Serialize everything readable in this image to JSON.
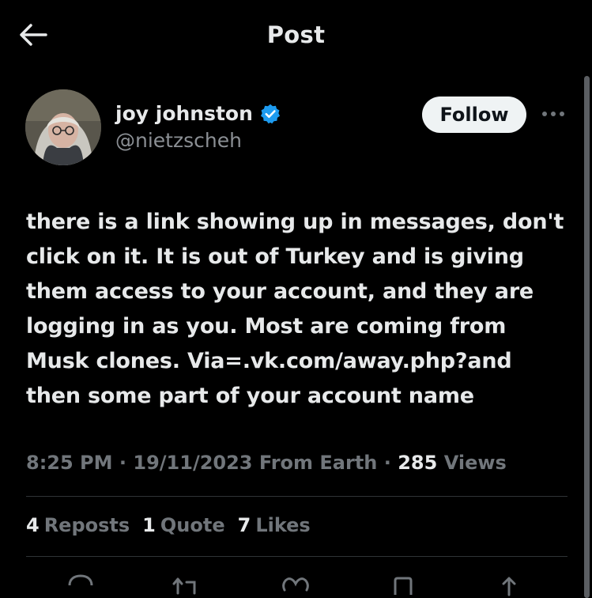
{
  "header": {
    "title": "Post",
    "back_icon": "arrow-left-icon"
  },
  "author": {
    "name": "joy johnston",
    "handle": "@nietzscheh",
    "verified": true,
    "verified_color": "#1d9bf0"
  },
  "follow_label": "Follow",
  "more_icon": "ellipsis-icon",
  "post": {
    "text": "there is a link showing up in messages, don't click on it.  It is out of Turkey and is giving them access to your account, and they are logging in as you.  Most are coming from Musk clones.  Via=.vk.com/away.php?and then some part of your account name"
  },
  "meta": {
    "time": "8:25 PM",
    "date": "19/11/2023",
    "source": "From Earth",
    "views_count": "285",
    "views_label": "Views"
  },
  "stats": {
    "reposts_count": "4",
    "reposts_label": "Reposts",
    "quotes_count": "1",
    "quotes_label": "Quote",
    "likes_count": "7",
    "likes_label": "Likes"
  },
  "actions": [
    "reply-icon",
    "repost-icon",
    "like-icon",
    "bookmark-icon",
    "share-icon"
  ],
  "colors": {
    "background": "#000000",
    "text_primary": "#e7e9ea",
    "text_secondary": "#71767b",
    "divider": "#2f3336",
    "follow_bg": "#eff3f4"
  }
}
